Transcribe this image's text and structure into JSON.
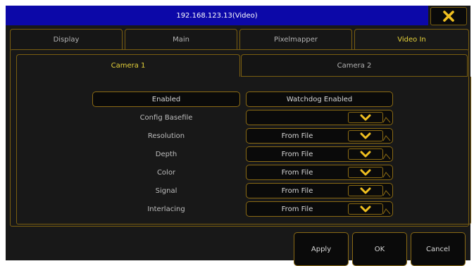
{
  "window": {
    "title": "192.168.123.13(Video)"
  },
  "tabs": [
    {
      "label": "Display",
      "active": false
    },
    {
      "label": "Main",
      "active": false
    },
    {
      "label": "Pixelmapper",
      "active": false
    },
    {
      "label": "Video In",
      "active": true
    }
  ],
  "subtabs": [
    {
      "label": "Camera 1",
      "active": true
    },
    {
      "label": "Camera 2",
      "active": false
    }
  ],
  "toggles": {
    "enabled_label": "Enabled",
    "watchdog_label": "Watchdog Enabled"
  },
  "settings": [
    {
      "label": "Config Basefile",
      "value": ""
    },
    {
      "label": "Resolution",
      "value": "From File"
    },
    {
      "label": "Depth",
      "value": "From File"
    },
    {
      "label": "Color",
      "value": "From File"
    },
    {
      "label": "Signal",
      "value": "From File"
    },
    {
      "label": "Interlacing",
      "value": "From File"
    }
  ],
  "actions": {
    "apply": "Apply",
    "ok": "OK",
    "cancel": "Cancel"
  },
  "colors": {
    "title_bar": "#0c08a8",
    "accent": "#e6d23a",
    "border": "#8a6a14",
    "background": "#181818"
  },
  "icons": {
    "close": "close-icon",
    "dropdown": "chevron-down-icon"
  }
}
